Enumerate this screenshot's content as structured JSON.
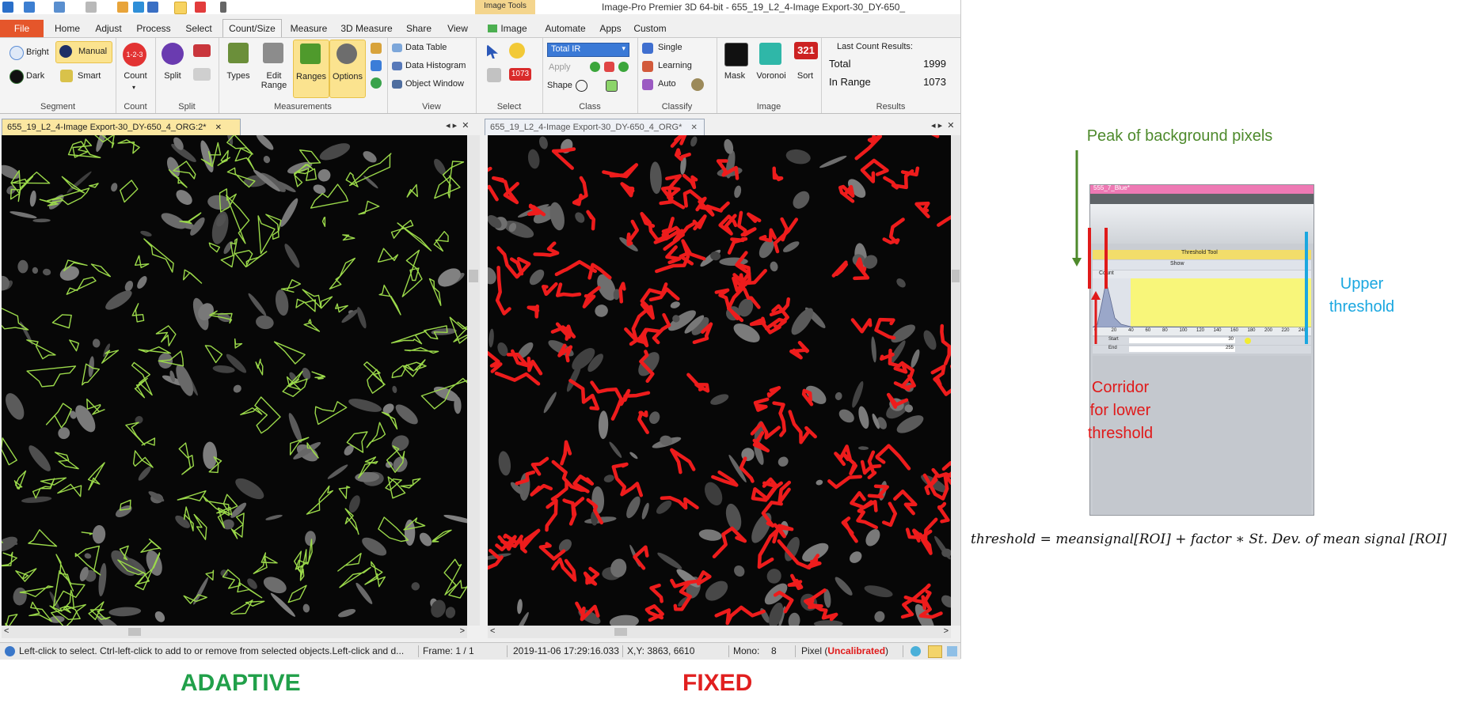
{
  "app": {
    "title": "Image-Pro Premier 3D 64-bit - 655_19_L2_4-Image Export-30_DY-650_",
    "context_tab": "Image Tools"
  },
  "tabs": [
    "File",
    "Home",
    "Adjust",
    "Process",
    "Select",
    "Count/Size",
    "Measure",
    "3D Measure",
    "Share",
    "View",
    "Image",
    "Automate",
    "Apps",
    "Custom"
  ],
  "active_tab": "Count/Size",
  "ribbon": {
    "segment": {
      "label": "Segment",
      "bright": "Bright",
      "manual": "Manual",
      "dark": "Dark",
      "smart": "Smart"
    },
    "count": {
      "label": "Count",
      "count_button": "Count",
      "icon_text": "1-2-3"
    },
    "split": {
      "label": "Split",
      "split_button": "Split"
    },
    "measurements": {
      "label": "Measurements",
      "types": "Types",
      "edit_range_1": "Edit",
      "edit_range_2": "Range",
      "ranges": "Ranges",
      "options": "Options"
    },
    "view": {
      "label": "View",
      "data_table": "Data Table",
      "data_histogram": "Data Histogram",
      "object_window": "Object Window"
    },
    "select": {
      "label": "Select",
      "count_badge": "1073"
    },
    "class": {
      "label": "Class",
      "dropdown": "Total IR",
      "apply": "Apply",
      "shape": "Shape"
    },
    "classify": {
      "label": "Classify",
      "single": "Single",
      "learning": "Learning",
      "auto": "Auto"
    },
    "image": {
      "label": "Image",
      "mask": "Mask",
      "voronoi": "Voronoi",
      "sort": "Sort",
      "sort_icon_text": "321"
    },
    "results": {
      "label": "Results",
      "heading": "Last Count Results:",
      "total_label": "Total",
      "total_value": "1999",
      "in_range_label": "In Range",
      "in_range_value": "1073"
    }
  },
  "documents": {
    "left_title": "655_19_L2_4-Image Export-30_DY-650_4_ORG:2*",
    "right_title": "655_19_L2_4-Image Export-30_DY-650_4_ORG*"
  },
  "status": {
    "hint": "Left-click to select.  Ctrl-left-click to add to or remove from selected objects.Left-click and d...",
    "frame": "Frame: 1 / 1",
    "timestamp": "2019-11-06 17:29:16.033",
    "coords": "X,Y: 3863, 6610",
    "mono_label": "Mono:",
    "mono_value": "8",
    "pixel_label": "Pixel (",
    "pixel_value": "Uncalibrated",
    "pixel_close": ")"
  },
  "captions": {
    "adaptive": "ADAPTIVE",
    "fixed": "FIXED",
    "adaptive_color": "#21a04a",
    "fixed_color": "#e11f1f"
  },
  "annotations": {
    "peak": "Peak of background pixels",
    "upper_1": "Upper",
    "upper_2": "threshold",
    "corridor_1": "Corridor",
    "corridor_2": "for lower",
    "corridor_3": "threshold",
    "peak_color": "#4e8a2c",
    "upper_color": "#1aa7e0",
    "corridor_color": "#e01a1a"
  },
  "inset": {
    "window_title": "555_7_Blue*",
    "tool_title": "Threshold Tool",
    "count_label": "Count",
    "show_label": "Show",
    "axis_ticks": [
      "0",
      "20",
      "40",
      "60",
      "80",
      "100",
      "120",
      "140",
      "160",
      "180",
      "200",
      "220",
      "240"
    ],
    "start_label": "Start",
    "start_value": "30",
    "end_label": "End",
    "end_value": "255"
  },
  "formula": "threshold = meansignal[ROI] + factor ∗ St. Dev. of mean signal [ROI]"
}
